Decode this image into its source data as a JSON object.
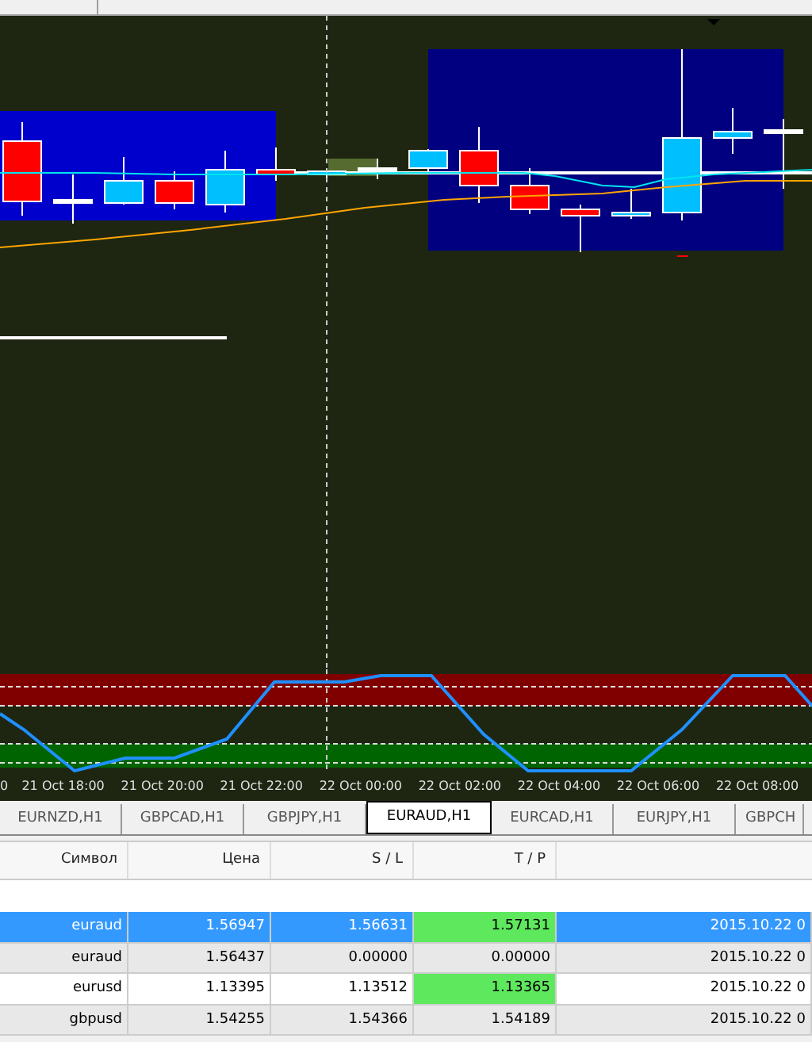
{
  "time_axis": [
    "0",
    "21 Oct 18:00",
    "21 Oct 20:00",
    "21 Oct 22:00",
    "22 Oct 00:00",
    "22 Oct 02:00",
    "22 Oct 04:00",
    "22 Oct 06:00",
    "22 Oct 08:00"
  ],
  "tabs": [
    {
      "label": "EURNZD,H1",
      "selected": false
    },
    {
      "label": "GBPCAD,H1",
      "selected": false
    },
    {
      "label": "GBPJPY,H1",
      "selected": false
    },
    {
      "label": "EURAUD,H1",
      "selected": true
    },
    {
      "label": "EURCAD,H1",
      "selected": false
    },
    {
      "label": "EURJPY,H1",
      "selected": false
    },
    {
      "label": "GBPCH",
      "selected": false
    }
  ],
  "table": {
    "columns": [
      "Символ",
      "Цена",
      "S / L",
      "T / P"
    ],
    "rows": [
      {
        "cells": [
          "euraud",
          "1.56947",
          "1.56631",
          "1.57131",
          "2015.10.22 0"
        ],
        "selected": true,
        "tp_highlight": true
      },
      {
        "cells": [
          "euraud",
          "1.56437",
          "0.00000",
          "0.00000",
          "2015.10.22 0"
        ],
        "selected": false,
        "tp_highlight": false
      },
      {
        "cells": [
          "eurusd",
          "1.13395",
          "1.13512",
          "1.13365",
          "2015.10.22 0"
        ],
        "selected": false,
        "tp_highlight": true
      },
      {
        "cells": [
          "gbpusd",
          "1.54255",
          "1.54366",
          "1.54189",
          "2015.10.22 0"
        ],
        "selected": false,
        "tp_highlight": false
      }
    ]
  }
}
